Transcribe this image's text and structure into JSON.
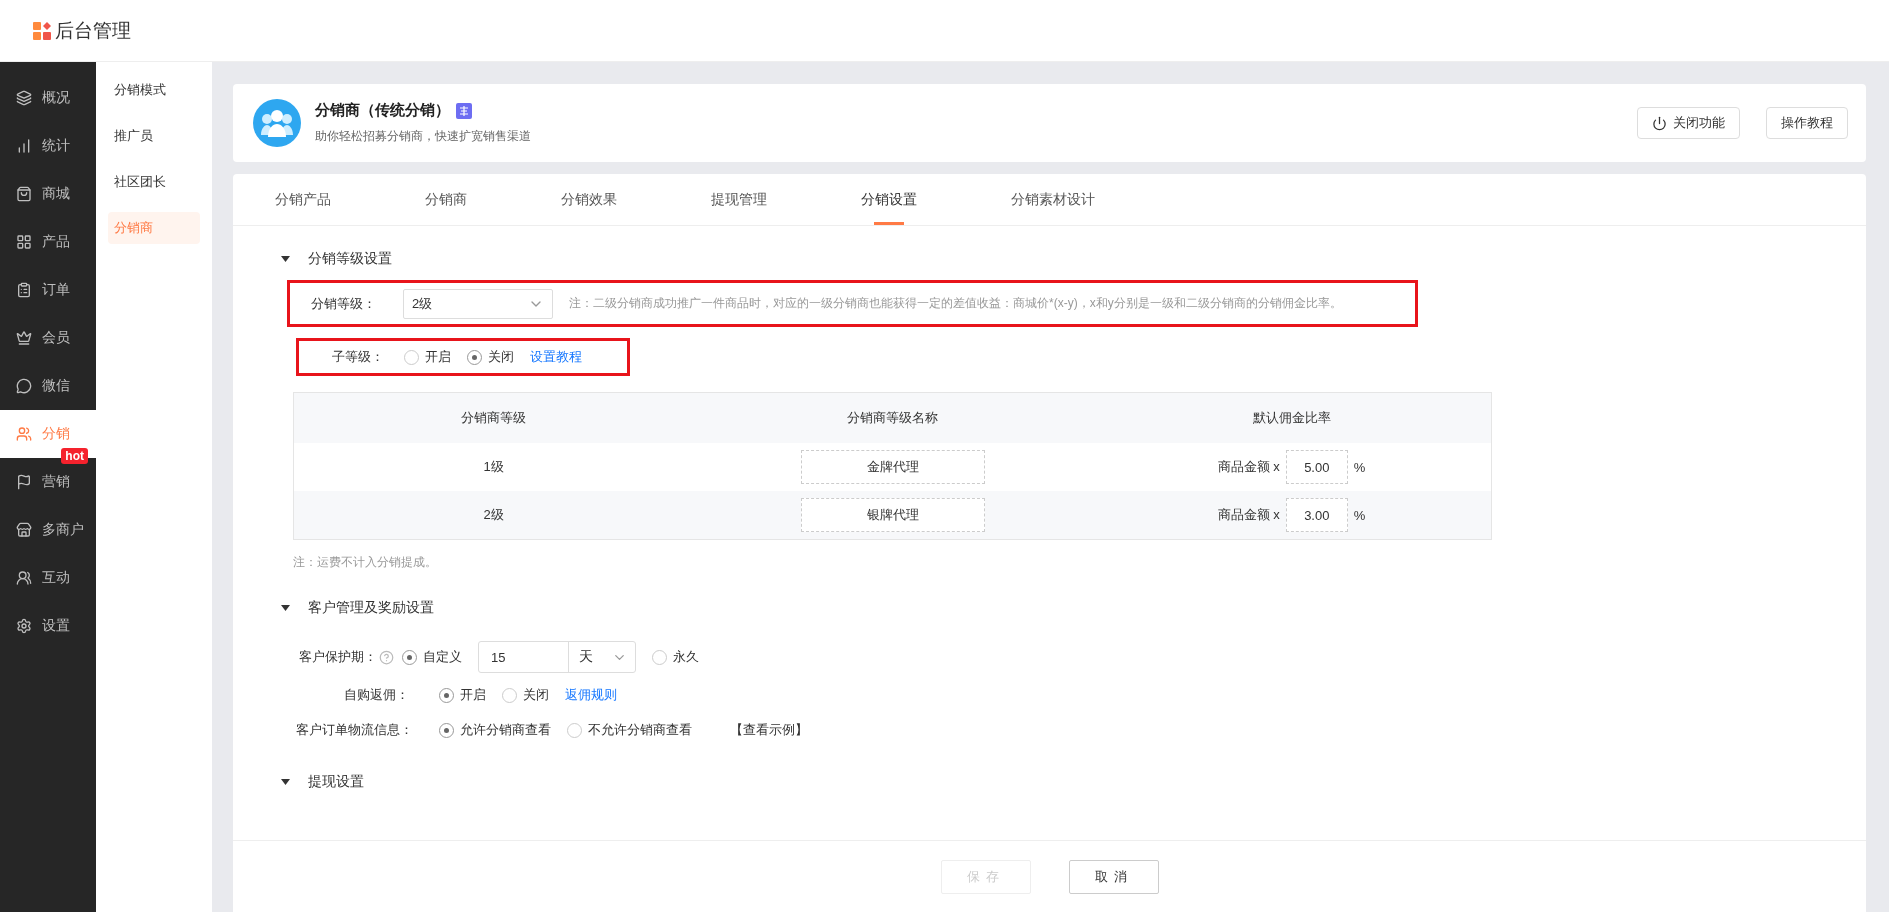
{
  "header": {
    "title": "后台管理"
  },
  "sidebar": {
    "items": [
      {
        "label": "概况",
        "selected": false
      },
      {
        "label": "统计",
        "selected": false
      },
      {
        "label": "商城",
        "selected": false
      },
      {
        "label": "产品",
        "selected": false
      },
      {
        "label": "订单",
        "selected": false
      },
      {
        "label": "会员",
        "selected": false
      },
      {
        "label": "微信",
        "selected": false
      },
      {
        "label": "分销",
        "selected": true
      },
      {
        "label": "营销",
        "selected": false,
        "badge": "hot"
      },
      {
        "label": "多商户",
        "selected": false
      },
      {
        "label": "互动",
        "selected": false
      },
      {
        "label": "设置",
        "selected": false
      }
    ]
  },
  "subnav": {
    "items": [
      {
        "label": "分销模式",
        "selected": false
      },
      {
        "label": "推广员",
        "selected": false
      },
      {
        "label": "社区团长",
        "selected": false
      },
      {
        "label": "分销商",
        "selected": true
      }
    ]
  },
  "feature": {
    "title": "分销商（传统分销）",
    "subtitle": "助你轻松招募分销商，快速扩宽销售渠道",
    "buttons": [
      {
        "label": "关闭功能",
        "kind": "power"
      },
      {
        "label": "操作教程",
        "kind": "plain"
      }
    ]
  },
  "tabs": [
    {
      "label": "分销产品",
      "selected": false
    },
    {
      "label": "分销商",
      "selected": false
    },
    {
      "label": "分销效果",
      "selected": false
    },
    {
      "label": "提现管理",
      "selected": false
    },
    {
      "label": "分销设置",
      "selected": true
    },
    {
      "label": "分销素材设计",
      "selected": false
    }
  ],
  "level_settings": {
    "title": "分销等级设置",
    "expanded": true,
    "level": {
      "label": "分销等级：",
      "value": "2级",
      "note": "注：二级分销商成功推广一件商品时，对应的一级分销商也能获得一定的差值收益：商城价*(x-y)，x和y分别是一级和二级分销商的分销佣金比率。"
    },
    "sub_level": {
      "label": "子等级：",
      "options": [
        {
          "label": "开启",
          "selected": false
        },
        {
          "label": "关闭",
          "selected": true
        }
      ],
      "link": "设置教程"
    },
    "table": {
      "columns": [
        "分销商等级",
        "分销商等级名称",
        "默认佣金比率"
      ],
      "rows": [
        {
          "level": "1级",
          "name": "金牌代理",
          "rate_prefix": "商品金额 x",
          "rate": "5.00",
          "unit": "%"
        },
        {
          "level": "2级",
          "name": "银牌代理",
          "rate_prefix": "商品金额 x",
          "rate": "3.00",
          "unit": "%"
        }
      ]
    },
    "note": "注：运费不计入分销提成。"
  },
  "customer_settings": {
    "title": "客户管理及奖励设置",
    "expanded": true,
    "protection": {
      "label": "客户保护期：",
      "options": [
        {
          "label": "自定义",
          "selected": true
        },
        {
          "label": "永久",
          "selected": false
        }
      ],
      "days": "15",
      "unit": "天"
    },
    "self_purchase": {
      "label": "自购返佣：",
      "options": [
        {
          "label": "开启",
          "selected": true
        },
        {
          "label": "关闭",
          "selected": false
        }
      ],
      "link": "返佣规则"
    },
    "logistics": {
      "label": "客户订单物流信息：",
      "options": [
        {
          "label": "允许分销商查看",
          "selected": true
        },
        {
          "label": "不允许分销商查看",
          "selected": false
        }
      ],
      "link": "【查看示例】"
    }
  },
  "withdraw_settings": {
    "title": "提现设置",
    "expanded": true
  },
  "footer": {
    "buttons": [
      {
        "label": "保存",
        "disabled": true
      },
      {
        "label": "取消",
        "disabled": false
      }
    ]
  }
}
